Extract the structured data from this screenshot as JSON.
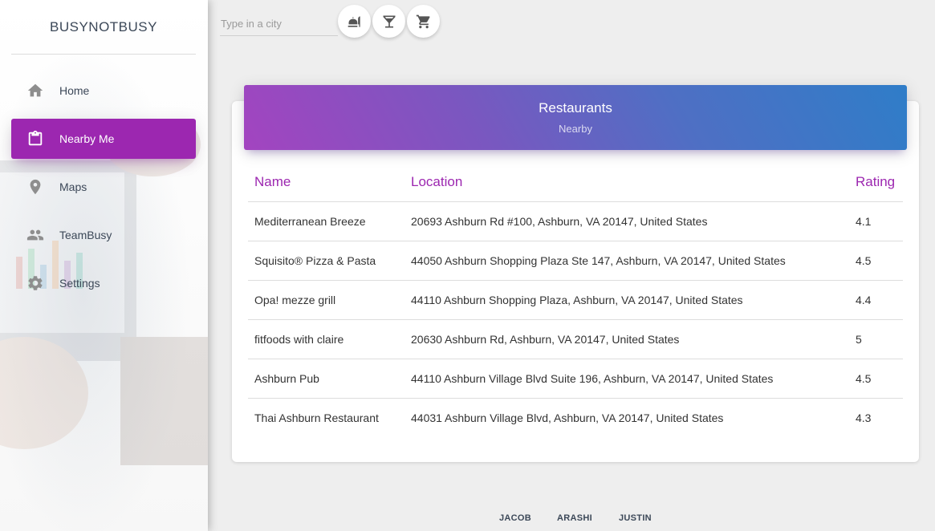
{
  "app": {
    "brand": "BUSYNOTBUSY"
  },
  "sidebar": {
    "items": [
      {
        "label": "Home",
        "icon": "home-icon"
      },
      {
        "label": "Nearby Me",
        "icon": "clipboard-icon",
        "active": true
      },
      {
        "label": "Maps",
        "icon": "location-pin-icon"
      },
      {
        "label": "TeamBusy",
        "icon": "people-icon"
      },
      {
        "label": "Settings",
        "icon": "gear-icon"
      }
    ]
  },
  "search": {
    "placeholder": "Type in a city",
    "value": ""
  },
  "toolbar": {
    "buttons": [
      {
        "icon": "restaurant-icon"
      },
      {
        "icon": "cocktail-icon"
      },
      {
        "icon": "cart-icon"
      }
    ]
  },
  "card": {
    "title": "Restaurants",
    "subtitle": "Nearby",
    "columns": [
      "Name",
      "Location",
      "Rating"
    ],
    "rows": [
      {
        "name": "Mediterranean Breeze",
        "location": "20693 Ashburn Rd #100, Ashburn, VA 20147, United States",
        "rating": "4.1"
      },
      {
        "name": "Squisito® Pizza & Pasta",
        "location": "44050 Ashburn Shopping Plaza Ste 147, Ashburn, VA 20147, United States",
        "rating": "4.5"
      },
      {
        "name": "Opa! mezze grill",
        "location": "44110 Ashburn Shopping Plaza, Ashburn, VA 20147, United States",
        "rating": "4.4"
      },
      {
        "name": "fitfoods with claire",
        "location": "20630 Ashburn Rd, Ashburn, VA 20147, United States",
        "rating": "5"
      },
      {
        "name": "Ashburn Pub",
        "location": "44110 Ashburn Village Blvd Suite 196, Ashburn, VA 20147, United States",
        "rating": "4.5"
      },
      {
        "name": "Thai Ashburn Restaurant",
        "location": "44031 Ashburn Village Blvd, Ashburn, VA 20147, United States",
        "rating": "4.3"
      }
    ]
  },
  "footer": {
    "links": [
      "JACOB",
      "ARASHI",
      "JUSTIN"
    ]
  },
  "colors": {
    "accent": "#9c27b0",
    "header_start": "#a344c0",
    "header_end": "#2f7dc8"
  }
}
